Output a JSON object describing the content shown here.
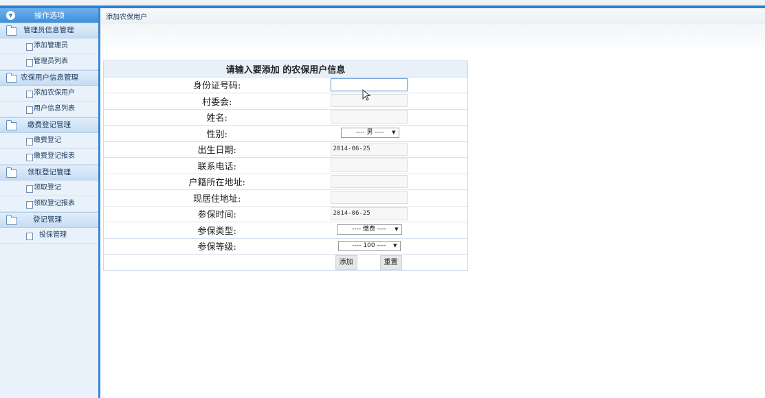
{
  "sidebar": {
    "header": "操作选项",
    "groups": [
      {
        "title": "管理员信息管理",
        "items": [
          "添加管理员",
          "管理员列表"
        ]
      },
      {
        "title": "农保用户信息管理",
        "items": [
          "添加农保用户",
          "用户信息列表"
        ]
      },
      {
        "title": "缴费登记管理",
        "items": [
          "缴费登记",
          "缴费登记报表"
        ]
      },
      {
        "title": "领取登记管理",
        "items": [
          "领取登记",
          "领取登记报表"
        ]
      },
      {
        "title": "登记管理",
        "items": [
          "投保管理"
        ]
      }
    ]
  },
  "breadcrumb": "添加农保用户",
  "form": {
    "title": "请输入要添加  的农保用户信息",
    "labels": {
      "id_number": "身份证号码:",
      "village": "村委会:",
      "name": "姓名:",
      "gender": "性别:",
      "birth_date": "出生日期:",
      "phone": "联系电话:",
      "hukou_address": "户籍所在地址:",
      "current_address": "现居住地址:",
      "insured_time": "参保时间:",
      "insured_type": "参保类型:",
      "insured_level": "参保等级:"
    },
    "values": {
      "id_number": "",
      "village": "",
      "name": "",
      "gender": "---- 男 ----",
      "birth_date": "2014-06-25",
      "phone": "",
      "hukou_address": "",
      "current_address": "",
      "insured_time": "2014-06-25",
      "insured_type": "---- 缴费 ----",
      "insured_level": "---- 100 ----"
    },
    "buttons": {
      "add": "添加",
      "reset": "重置"
    }
  }
}
